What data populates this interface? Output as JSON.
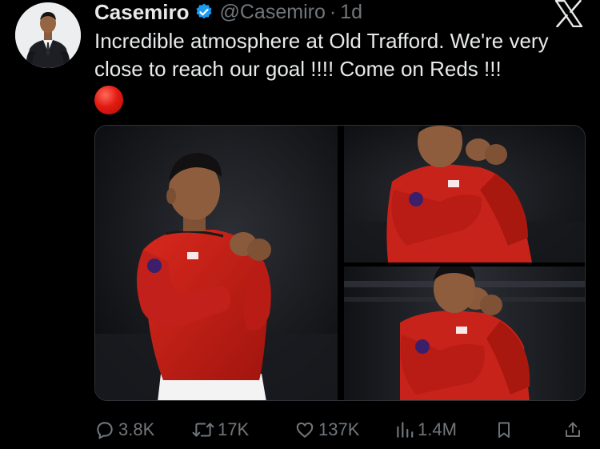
{
  "author": {
    "display_name": "Casemiro",
    "handle": "@Casemiro",
    "separator": "·",
    "timestamp": "1d",
    "verified": true,
    "verified_color": "#1d9bf0"
  },
  "tweet": {
    "text": "Incredible atmosphere at Old Trafford. We're very close to reach our goal !!!! Come on Reds !!!",
    "emoji": "red-circle"
  },
  "media": {
    "count": 3
  },
  "actions": {
    "replies": "3.8K",
    "reposts": "17K",
    "likes": "137K",
    "views": "1.4M"
  },
  "icons": {
    "reply": "speech-bubble-icon",
    "repost": "repost-arrows-icon",
    "like": "heart-icon",
    "views": "bar-chart-icon",
    "bookmark": "bookmark-icon",
    "share": "share-icon",
    "brand": "x-logo-icon"
  },
  "colors": {
    "background": "#000000",
    "text": "#e7e9ea",
    "muted": "#71767b",
    "jersey": "#c8231a"
  }
}
